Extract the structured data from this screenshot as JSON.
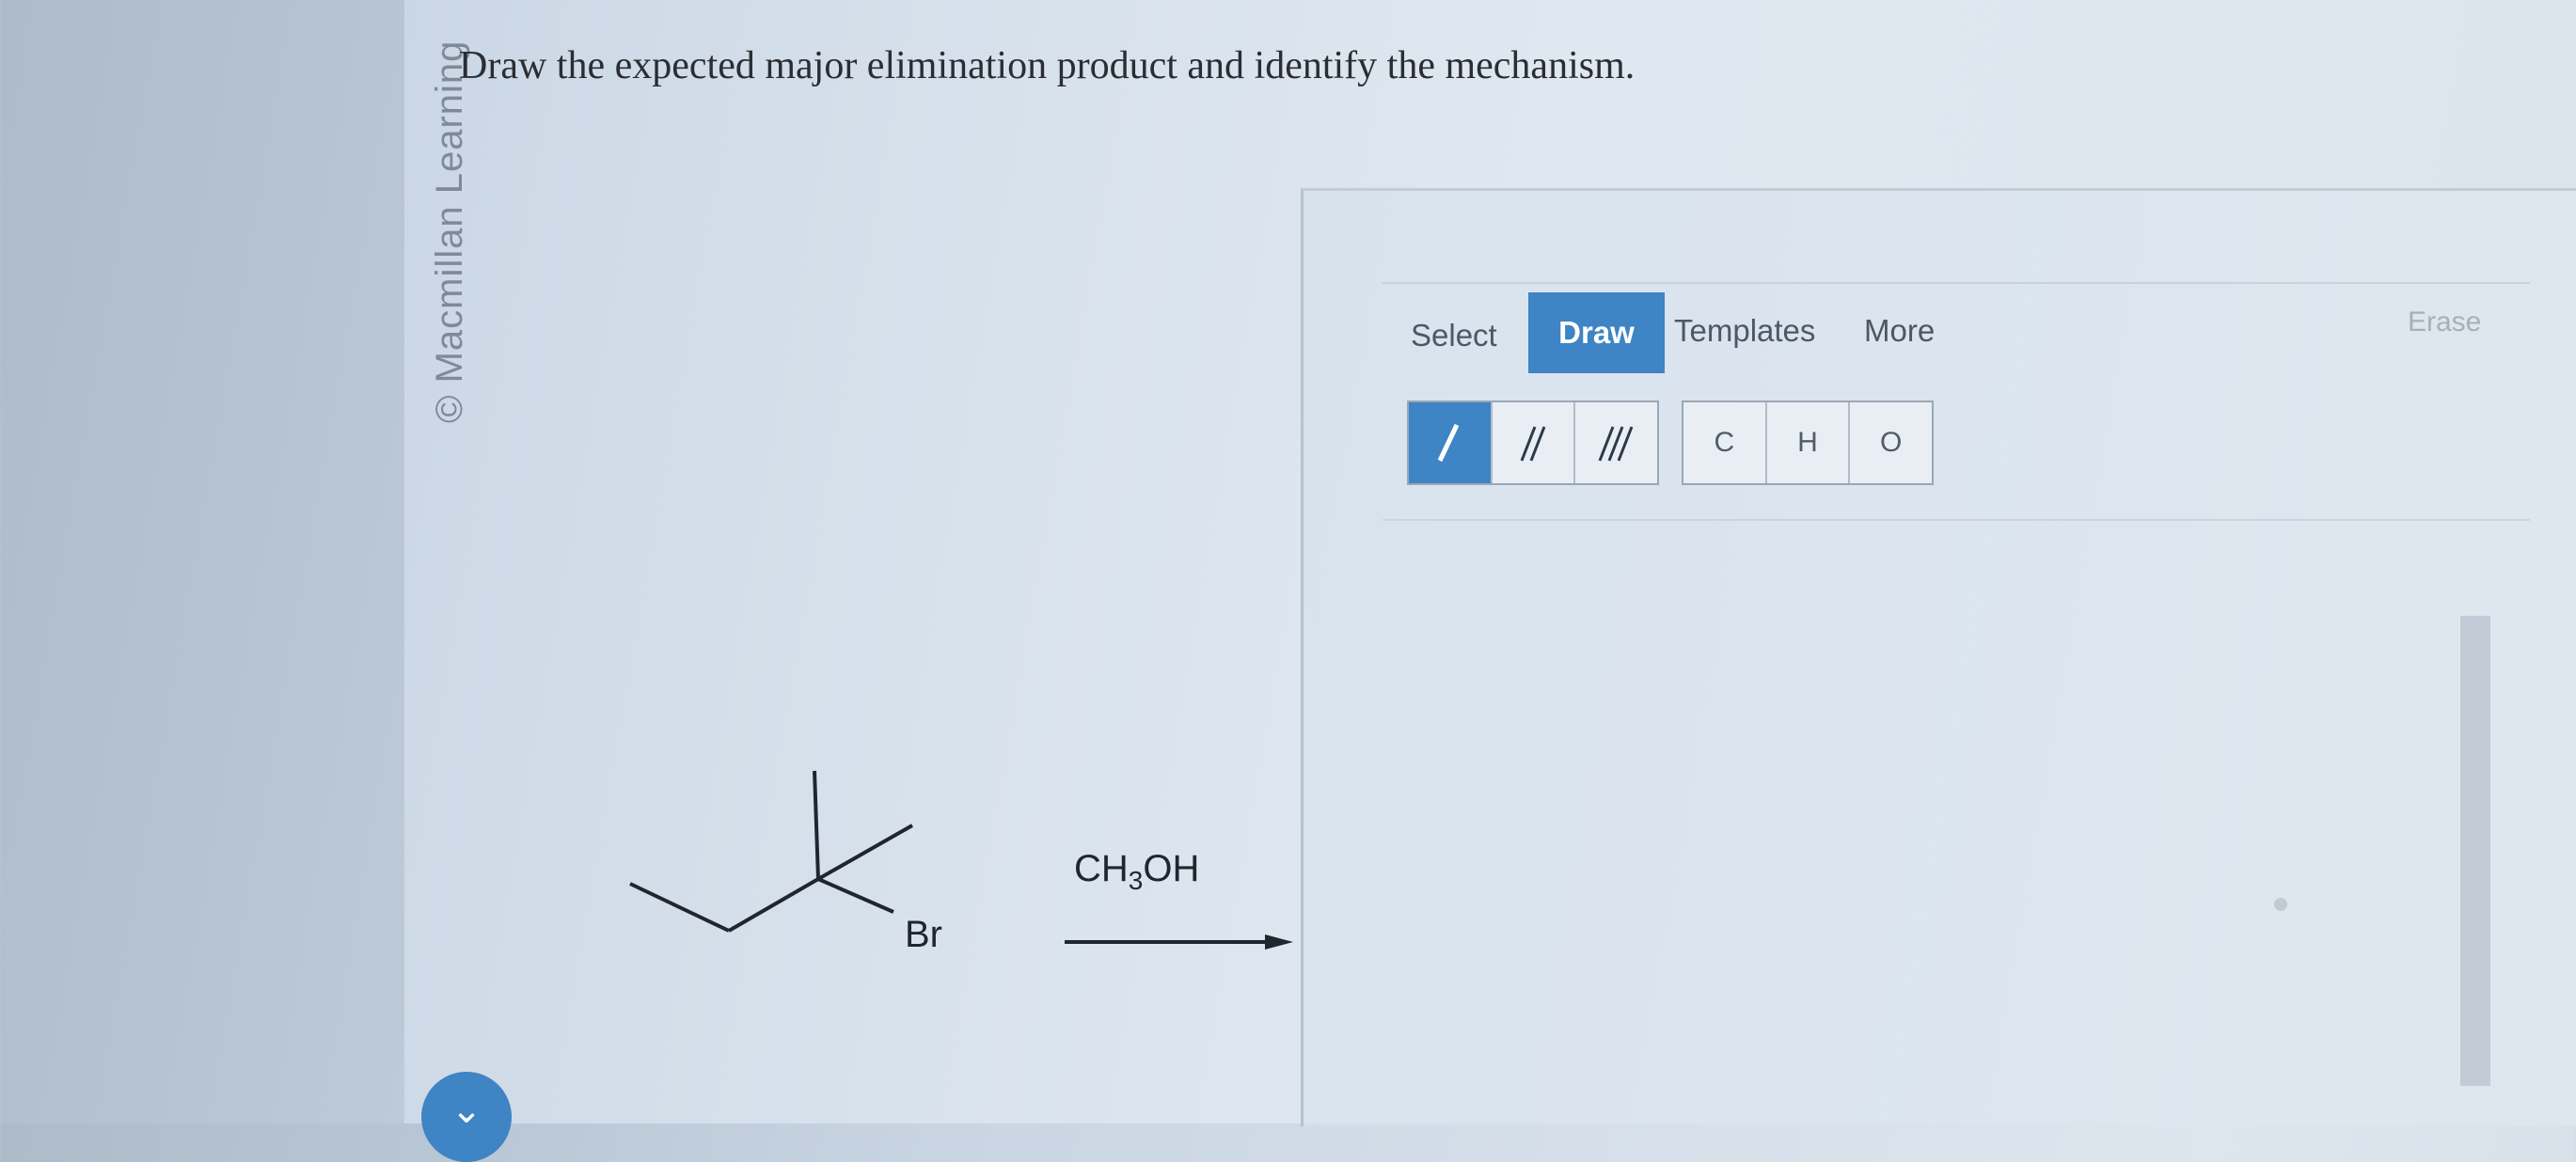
{
  "watermark": "© Macmillan Learning",
  "question": "Draw the expected major elimination product and identify the mechanism.",
  "toolbar": {
    "tabs": [
      "Select",
      "Draw",
      "Templates",
      "More"
    ],
    "erase": "Erase",
    "bond_tools": [
      "/",
      "//",
      "///"
    ],
    "atom_tools": [
      "C",
      "H",
      "O"
    ]
  },
  "reaction": {
    "leaving_group": "Br",
    "reagent_prefix": "CH",
    "reagent_sub": "3",
    "reagent_suffix": "OH"
  },
  "colors": {
    "accent": "#3f84c4"
  },
  "icons": {
    "scroll": "chevron-down-icon"
  }
}
